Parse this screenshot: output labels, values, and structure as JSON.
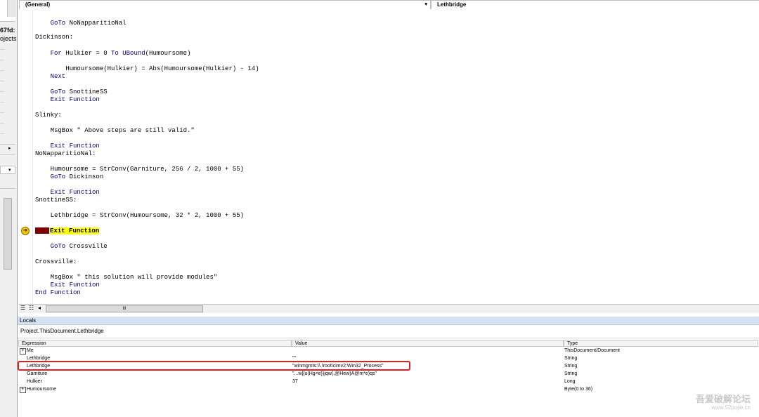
{
  "left_panel": {
    "texts": [
      "67fd:",
      "ojects"
    ]
  },
  "toolbar": {
    "object_combo": "(General)",
    "procedure_combo": "Lethbridge",
    "dropdown_arrow": "▾"
  },
  "code": {
    "lines": [
      {
        "tokens": [
          {
            "t": "    "
          },
          {
            "t": "GoTo",
            "k": 1
          },
          {
            "t": " NoNapparitioNal"
          }
        ]
      },
      {
        "tokens": [
          {
            "t": "Dickinson:"
          }
        ]
      },
      {
        "tokens": [
          {
            "t": "    "
          },
          {
            "t": "For",
            "k": 1
          },
          {
            "t": " Hulkier = 0 "
          },
          {
            "t": "To",
            "k": 1
          },
          {
            "t": " "
          },
          {
            "t": "UBound",
            "k": 1
          },
          {
            "t": "(Humoursome)"
          }
        ]
      },
      {
        "tokens": [
          {
            "t": "        Humoursome(Hulkier) = Abs(Humoursome(Hulkier) - 14)"
          }
        ]
      },
      {
        "tokens": [
          {
            "t": "    "
          },
          {
            "t": "Next",
            "k": 1
          }
        ]
      },
      {
        "tokens": [
          {
            "t": "    "
          },
          {
            "t": "GoTo",
            "k": 1
          },
          {
            "t": " SnottineSS"
          }
        ]
      },
      {
        "tokens": [
          {
            "t": "    "
          },
          {
            "t": "Exit Function",
            "k": 1
          }
        ]
      },
      {
        "tokens": [
          {
            "t": "Slinky:"
          }
        ]
      },
      {
        "tokens": [
          {
            "t": "    MsgBox \" Above steps are still valid.\""
          }
        ]
      },
      {
        "tokens": [
          {
            "t": "    "
          },
          {
            "t": "Exit Function",
            "k": 1
          }
        ]
      },
      {
        "tokens": [
          {
            "t": "NoNapparitioNal:"
          }
        ]
      },
      {
        "tokens": [
          {
            "t": "    Humoursome = StrConv(Garniture, 256 / 2, 1000 + 55)"
          }
        ]
      },
      {
        "tokens": [
          {
            "t": "    "
          },
          {
            "t": "GoTo",
            "k": 1
          },
          {
            "t": " Dickinson"
          }
        ]
      },
      {
        "tokens": [
          {
            "t": "    "
          },
          {
            "t": "Exit Function",
            "k": 1
          }
        ]
      },
      {
        "tokens": [
          {
            "t": "SnottineSS:"
          }
        ]
      },
      {
        "tokens": [
          {
            "t": "    Lethbridge = StrConv(Humoursome, 32 * 2, 1000 + 55)"
          }
        ]
      },
      {
        "current": true,
        "tokens": [
          {
            "t": "Exit Function",
            "k": 1
          }
        ]
      },
      {
        "tokens": [
          {
            "t": "    "
          },
          {
            "t": "GoTo",
            "k": 1
          },
          {
            "t": " Crossville"
          }
        ]
      },
      {
        "tokens": [
          {
            "t": "Crossville:"
          }
        ]
      },
      {
        "tokens": [
          {
            "t": "    MsgBox \" this solution will provide modules\""
          }
        ]
      },
      {
        "tokens": [
          {
            "t": "    "
          },
          {
            "t": "Exit Function",
            "k": 1
          }
        ]
      },
      {
        "tokens": [
          {
            "t": "End Function",
            "k": 1
          }
        ]
      }
    ]
  },
  "locals": {
    "title": "Locals",
    "context": "Project.ThisDocument.Lethbridge",
    "columns": [
      "Expression",
      "Value",
      "Type"
    ],
    "rows": [
      {
        "expression": "Me",
        "value": "",
        "type": "ThisDocument/Document",
        "expandable": true
      },
      {
        "expression": "Lethbridge",
        "value": "\"\"",
        "type": "String",
        "expandable": false
      },
      {
        "expression": "Lethbridge",
        "value": "\"winmgmts:\\\\.\\root\\cimv2:Win32_Process\"",
        "type": "String",
        "expandable": false
      },
      {
        "expression": "Garniture",
        "value": "\"...w|{u(Hg<e}}jqw(,@Hew)A@m*e)qs\"",
        "type": "String",
        "expandable": false
      },
      {
        "expression": "Hulkier",
        "value": "37",
        "type": "Long",
        "expandable": false
      },
      {
        "expression": "Humoursome",
        "value": "",
        "type": "Byte(0 to 36)",
        "expandable": true
      }
    ]
  },
  "scroll_grip": "III",
  "watermark": {
    "title": "吾爱破解论坛",
    "sub": "www.52pojie.cn"
  },
  "colors": {
    "keyword": "#00008b",
    "current_line": "#ffff00",
    "breakpoint": "#800000",
    "highlight_box": "#e02020"
  },
  "icons": [
    "exec-arrow-icon",
    "plus-icon",
    "dropdown-arrow-icon",
    "scroll-left-icon",
    "split-view-icon"
  ]
}
